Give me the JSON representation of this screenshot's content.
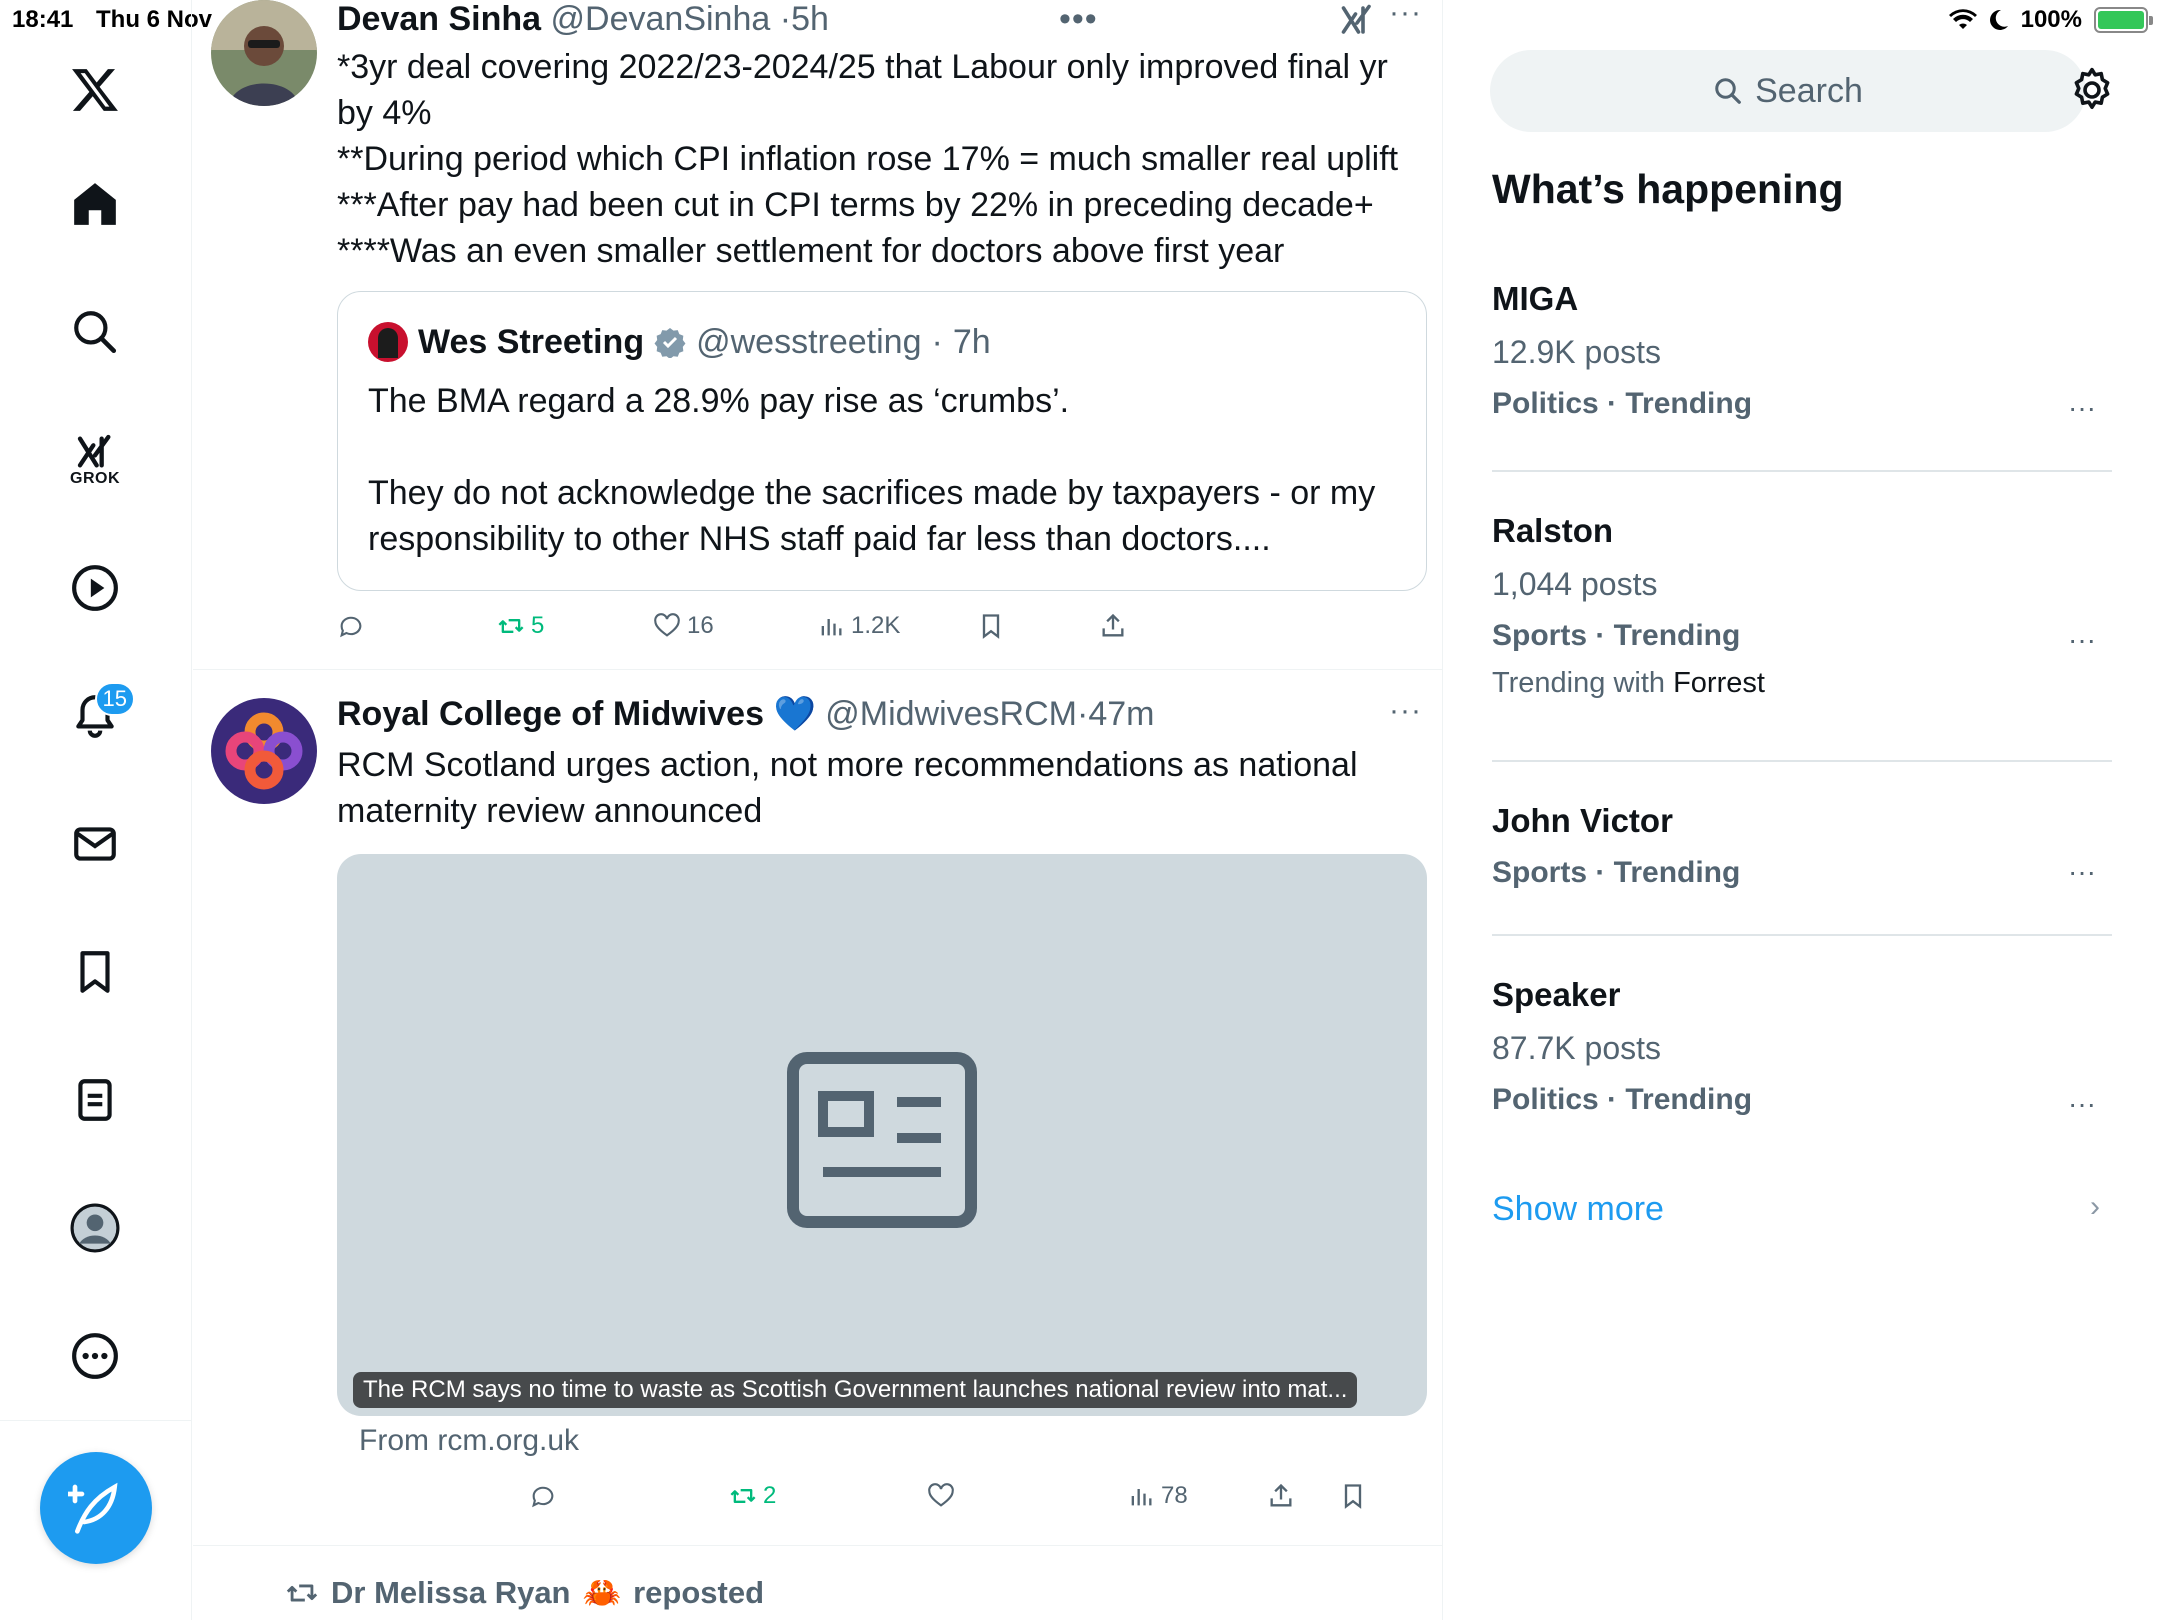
{
  "status_bar": {
    "time": "18:41",
    "date": "Thu 6 Nov",
    "battery": "100%",
    "battery_level": 1.0
  },
  "nav": {
    "grok_label": "GROK",
    "notifications_badge": "15"
  },
  "tweets": [
    {
      "name": "Devan Sinha",
      "handle": "@DevanSinha",
      "time": "5h",
      "lines": [
        "*3yr deal covering 2022/23-2024/25 that Labour only improved final yr",
        "by 4%",
        "**During period which CPI inflation rose 17% = much smaller real uplift",
        "***After pay had been cut in CPI terms by 22% in preceding decade+",
        "****Was an even smaller settlement for doctors above first year"
      ],
      "quote": {
        "name": "Wes Streeting",
        "handle": "@wesstreeting",
        "time": "7h",
        "line1": "The BMA regard a 28.9% pay rise as ‘crumbs’.",
        "line2": "They do not acknowledge the sacrifices made by taxpayers - or my",
        "line3": "responsibility to other NHS staff paid far less than doctors...."
      },
      "stats": {
        "reposts": "5",
        "likes": "16",
        "views": "1.2K"
      }
    },
    {
      "name": "Royal College of Midwives",
      "emoji": "💙",
      "handle": "@MidwivesRCM",
      "time": "47m",
      "lines": [
        "RCM Scotland urges action, not more recommendations as national",
        "maternity review announced"
      ],
      "card_caption": "The RCM says no time to waste as Scottish Government launches national review into mat...",
      "card_source": "From rcm.org.uk",
      "stats": {
        "reposts": "2",
        "views": "78"
      }
    }
  ],
  "repost_banner": {
    "user": "Dr Melissa Ryan",
    "emoji": "🦀",
    "action": "reposted"
  },
  "sidebar": {
    "search_placeholder": "Search",
    "title": "What’s happening",
    "trends": [
      {
        "name": "MIGA",
        "posts": "12.9K posts",
        "category": "Politics · Trending"
      },
      {
        "name": "Ralston",
        "posts": "1,044 posts",
        "category": "Sports · Trending",
        "with_prefix": "Trending with",
        "with_name": "Forrest"
      },
      {
        "name": "John Victor",
        "category": "Sports · Trending"
      },
      {
        "name": "Speaker",
        "posts": "87.7K posts",
        "category": "Politics · Trending"
      }
    ],
    "show_more": "Show more"
  },
  "colors": {
    "accent": "#1d9bf0",
    "text": "#0f1419",
    "muted": "#536471",
    "repost_green": "#00ba7c",
    "border": "#eff3f4"
  }
}
